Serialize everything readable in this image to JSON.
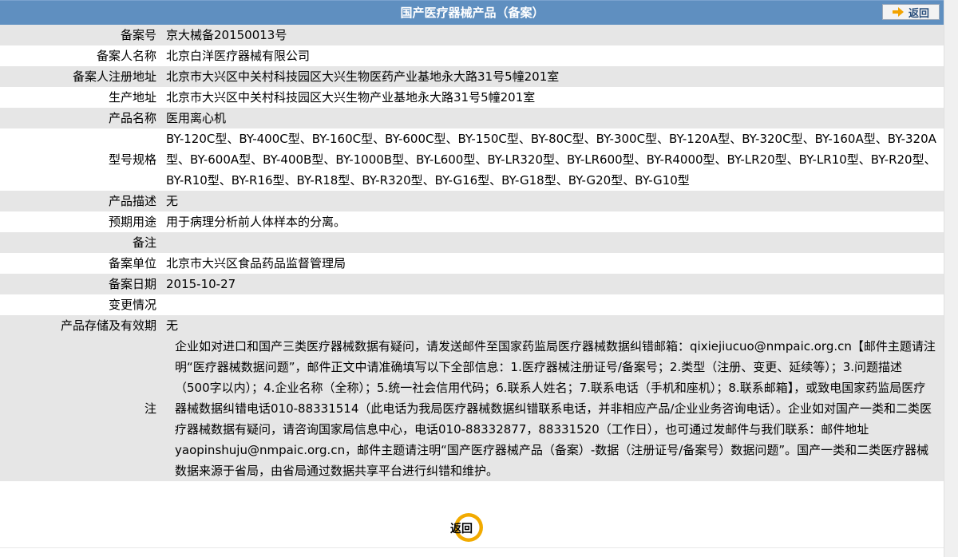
{
  "header": {
    "title": "国产医疗器械产品（备案）",
    "back_button": "返回",
    "back_icon": "arrow-right-icon"
  },
  "rows": [
    {
      "label": "备案号",
      "value": "京大械备20150013号"
    },
    {
      "label": "备案人名称",
      "value": "北京白洋医疗器械有限公司"
    },
    {
      "label": "备案人注册地址",
      "value": "北京市大兴区中关村科技园区大兴生物医药产业基地永大路31号5幢201室"
    },
    {
      "label": "生产地址",
      "value": "北京市大兴区中关村科技园区大兴生物产业基地永大路31号5幢201室"
    },
    {
      "label": "产品名称",
      "value": "医用离心机"
    },
    {
      "label": "型号规格",
      "value": "BY-120C型、BY-400C型、BY-160C型、BY-600C型、BY-150C型、BY-80C型、BY-300C型、BY-120A型、BY-320C型、BY-160A型、BY-320A型、BY-600A型、BY-400B型、BY-1000B型、BY-L600型、BY-LR320型、BY-LR600型、BY-R4000型、BY-LR20型、BY-LR10型、BY-R20型、BY-R10型、BY-R16型、BY-R18型、BY-R320型、BY-G16型、BY-G18型、BY-G20型、BY-G10型"
    },
    {
      "label": "产品描述",
      "value": "无"
    },
    {
      "label": "预期用途",
      "value": "用于病理分析前人体样本的分离。"
    },
    {
      "label": "备注",
      "value": ""
    },
    {
      "label": "备案单位",
      "value": "北京市大兴区食品药品监督管理局"
    },
    {
      "label": "备案日期",
      "value": "2015-10-27"
    },
    {
      "label": "变更情况",
      "value": ""
    },
    {
      "label": "产品存储及有效期",
      "value": "无"
    }
  ],
  "note": {
    "label": "注",
    "text": "企业如对进口和国产三类医疗器械数据有疑问，请发送邮件至国家药监局医疗器械数据纠错邮箱：qixiejiucuo@nmpaic.org.cn【邮件主题请注明“医疗器械数据问题”，邮件正文中请准确填写以下全部信息：1.医疗器械注册证号/备案号；2.类型（注册、变更、延续等）；3.问题描述（500字以内）；4.企业名称（全称）；5.统一社会信用代码；6.联系人姓名；7.联系电话（手机和座机）；8.联系邮箱】，或致电国家药监局医疗器械数据纠错电话010-88331514（此电话为我局医疗器械数据纠错联系电话，并非相应产品/企业业务咨询电话）。企业如对国产一类和二类医疗器械数据有疑问，请咨询国家局信息中心，电话010-88332877，88331520（工作日），也可通过发邮件与我们联系：邮件地址yaopinshuju@nmpaic.org.cn，邮件主题请注明“国产医疗器械产品（备案）-数据（注册证号/备案号）数据问题”。国产一类和二类医疗器械数据来源于省局，由省局通过数据共享平台进行纠错和维护。"
  },
  "footer": {
    "back_label": "返回"
  },
  "colors": {
    "header_bg": "#5f8fc0",
    "row_alt_bg": "#e6e6e6",
    "accent_ring": "#f4b400"
  }
}
